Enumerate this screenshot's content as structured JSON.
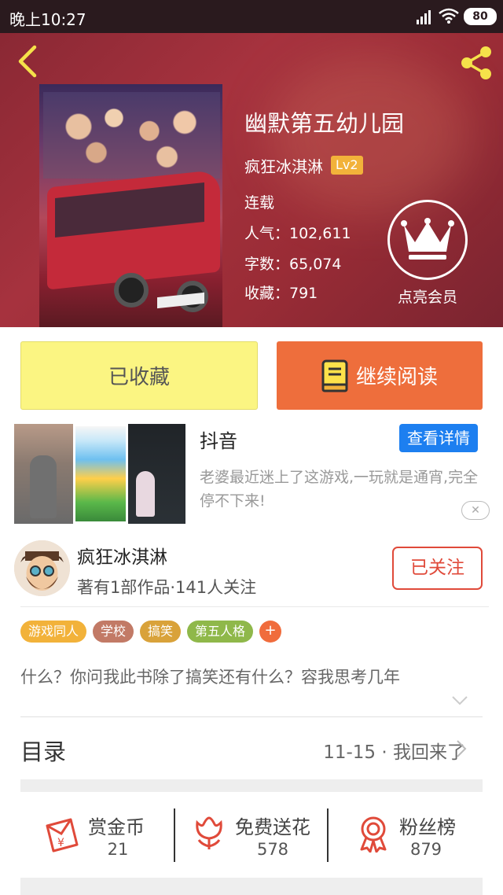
{
  "status_bar": {
    "time": "晚上10:27",
    "battery": "80"
  },
  "book": {
    "title": "幽默第五幼儿园",
    "author": "疯狂冰淇淋",
    "level": "Lv2",
    "status": "连载",
    "popularity": "人气：102,611",
    "word_count": "字数：65,074",
    "favorites": "收藏：791"
  },
  "vip": {
    "label": "点亮会员"
  },
  "actions": {
    "favorited_label": "已收藏",
    "continue_label": "继续阅读"
  },
  "ad": {
    "title": "抖音",
    "button": "查看详情",
    "description": "老婆最近迷上了这游戏,一玩就是通宵,完全停不下来!",
    "close": "✕"
  },
  "author_card": {
    "name": "疯狂冰淇淋",
    "subtitle": "著有1部作品·141人关注",
    "follow_label": "已关注"
  },
  "tags": [
    {
      "label": "游戏同人",
      "color": "#f2b23a"
    },
    {
      "label": "学校",
      "color": "#c27a66"
    },
    {
      "label": "搞笑",
      "color": "#d9a23a"
    },
    {
      "label": "第五人格",
      "color": "#8fb84a"
    }
  ],
  "tag_add": "+",
  "summary": "什么？你问我此书除了搞笑还有什么？容我思考几年",
  "toc": {
    "label": "目录",
    "latest": "11-15 · 我回来了"
  },
  "stats": [
    {
      "label": "赏金币",
      "value": "21",
      "icon": "reward-coin-icon"
    },
    {
      "label": "免费送花",
      "value": "578",
      "icon": "flower-icon"
    },
    {
      "label": "粉丝榜",
      "value": "879",
      "icon": "medal-icon"
    }
  ],
  "colors": {
    "accent": "#ee6e3c",
    "favorite_bg": "#fbf582",
    "ad_button": "#1d7ff0",
    "hero": "#a6323e"
  }
}
